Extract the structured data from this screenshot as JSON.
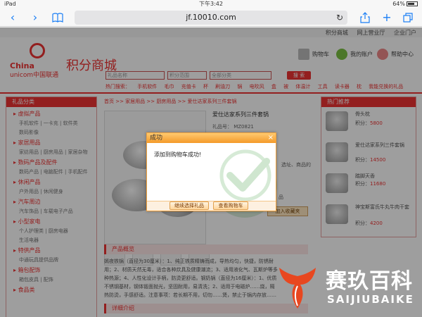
{
  "status_bar": {
    "device": "iPad",
    "time": "下午3:42",
    "battery": "64%"
  },
  "browser": {
    "url": "jf.10010.com",
    "icons": {
      "back": "back-icon",
      "forward": "forward-icon",
      "bookmarks": "bookmarks-icon",
      "reload": "reload-icon",
      "share": "share-icon",
      "new_tab": "new-tab-icon",
      "tabs": "tabs-icon"
    }
  },
  "header": {
    "toplinks": [
      "积分商城",
      "网上营业厅",
      "企业门户"
    ],
    "logo_en_1": "China",
    "logo_en_2": "unicom中国联通",
    "logo_title": "积分商城",
    "cart": "购物车",
    "account": "我的账户",
    "help": "帮助中心"
  },
  "search": {
    "placeholder": "礼品名称",
    "range_select": "积分范围",
    "category_select": "全部分类",
    "button": "搜 索"
  },
  "hot_searches": {
    "label": "热门搜索：",
    "items": [
      "手机软件",
      "毛巾",
      "充值卡",
      "杯",
      "刷油刀",
      "锅",
      "电吹风",
      "盒",
      "被",
      "体温计",
      "工具",
      "读卡器",
      "枕"
    ],
    "history": "我能兑换的礼品"
  },
  "left_sidebar": {
    "title": "礼品分类",
    "categories": [
      {
        "name": "虚拟产品",
        "subs": "手机软件 | 一卡充 | 软件类"
      },
      {
        "name": "",
        "subs": "数码影像"
      },
      {
        "name": "家居用品",
        "subs": "家纺用品 | 厨房用品 | 家居杂物"
      },
      {
        "name": "数码产品及配件",
        "subs": "数码产品 | 电脑配件 | 手机配件"
      },
      {
        "name": "休闲产品",
        "subs": "户外用品 | 休闲健身"
      },
      {
        "name": "汽车周边",
        "subs": "汽车饰品 | 车载电子产品"
      },
      {
        "name": "小型家电",
        "subs": "个人护理类 | 厨房电器"
      },
      {
        "name": "",
        "subs": "生活电器"
      },
      {
        "name": "特供产品",
        "subs": "中通玩具提供品牌"
      },
      {
        "name": "箱包配饰",
        "subs": "箱包皮具 | 配饰"
      },
      {
        "name": "食品类",
        "subs": ""
      }
    ]
  },
  "breadcrumb": "首页  >>  家居用品  >>  厨房用品  >>  爱仕达家系列三件套锅",
  "product": {
    "title": "爱仕达家系列三件套锅",
    "code": "礼品号：  MZ0821",
    "fragment_1": "选址、商品的",
    "fragment_2": "品",
    "collect_button": "加入收藏夹",
    "overview_heading": "产品概览",
    "description": "嫣夜铁锅（直径为30厘米）：1、纯正铁质精铸而成，导热均匀，快捷，防锈耐用；2、材质天然无毒，适合各种炊具及健康潮流；3、适用液化气、瓦斯炉等多种热源；4、人性化设计手柄，防烫更舒适。钢奶锅（直径为16厘米）：1、优质不锈钢基材，钢体锻面抛光，坚固耐用，易清洗；2、适用于电磁炉……烧，隔热防烫，手感舒适。注意事项：若长期不用，切勿……煲，禁止于锅内存放……",
    "details_heading": "详细介绍"
  },
  "right_sidebar": {
    "title": "热门推荐",
    "items": [
      {
        "name": "骨头枕",
        "points_label": "积分：",
        "points": "5800"
      },
      {
        "name": "爱仕达家系列三件套锅",
        "points_label": "积分：",
        "points": "14500"
      },
      {
        "name": "踏脚天香",
        "points_label": "积分：",
        "points": "11680"
      },
      {
        "name": "神宝斯富氏牛丸牛肉干套",
        "points_label": "积分：",
        "points": "4200"
      }
    ]
  },
  "dialog": {
    "title": "成功",
    "close_glyph": "×",
    "message": "添加到购物车成功!",
    "continue_button": "继续选择礼品",
    "view_cart_button": "查看购物车"
  },
  "watermark": {
    "cn": "赛玖百科",
    "en": "SAIJIUBAIKE"
  },
  "colors": {
    "brand_red": "#e33333",
    "dialog_orange": "#f49a2a",
    "link_blue": "#1a7ef5"
  }
}
